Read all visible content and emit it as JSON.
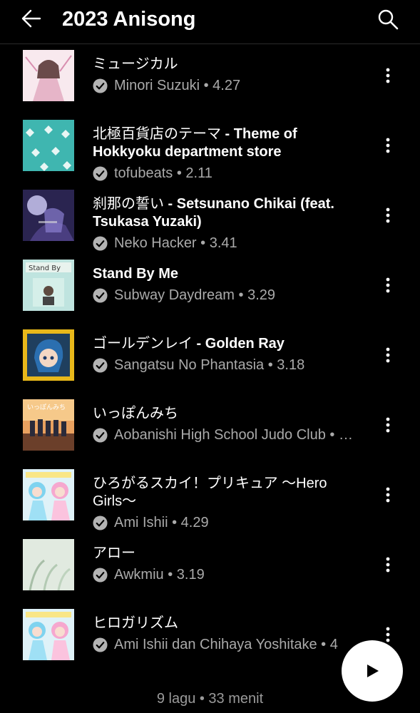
{
  "header": {
    "title": "2023 Anisong",
    "back_icon": "arrow-left-icon",
    "search_icon": "search-icon"
  },
  "songs": [
    {
      "title_jp": "ミュージカル",
      "title_en": "",
      "meta": "Minori Suzuki • 4.27",
      "cover": "pink-portrait"
    },
    {
      "title_jp": "北極百貨店のテーマ",
      "title_en": " - Theme of Hokkyoku department store",
      "meta": "tofubeats • 2.11",
      "cover": "teal-pattern"
    },
    {
      "title_jp": "刹那の誓い",
      "title_en": " - Setsunano Chikai (feat. Tsukasa Yuzaki)",
      "meta": "Neko Hacker • 3.41",
      "cover": "night-purple"
    },
    {
      "title_jp": "",
      "title_en": "Stand By Me",
      "meta": "Subway Daydream • 3.29",
      "cover": "mint-collage"
    },
    {
      "title_jp": "ゴールデンレイ",
      "title_en": " - Golden Ray",
      "meta": "Sangatsu No Phantasia • 3.18",
      "cover": "yellow-anime"
    },
    {
      "title_jp": "いっぽんみち",
      "title_en": "",
      "meta": "Aobanishi High School Judo Club • …",
      "cover": "sunset-group"
    },
    {
      "title_jp": "ひろがるスカイ！プリキュア 〜Hero Girls〜",
      "title_en": "",
      "meta": "Ami Ishii • 4.29",
      "cover": "precure"
    },
    {
      "title_jp": "アロー",
      "title_en": "",
      "meta": "Awkmiu • 3.19",
      "cover": "pale-green"
    },
    {
      "title_jp": "ヒロガリズム",
      "title_en": "",
      "meta": "Ami Ishii dan Chihaya Yoshitake • 4",
      "cover": "precure"
    }
  ],
  "footer": {
    "summary": "9 lagu • 33 menit"
  },
  "icons": {
    "verified": "verified-check-icon",
    "more": "more-vertical-icon",
    "play": "play-icon"
  },
  "colors": {
    "background": "#000000",
    "text": "#ffffff",
    "secondary_text": "#aaaaaa",
    "fab": "#ffffff"
  }
}
